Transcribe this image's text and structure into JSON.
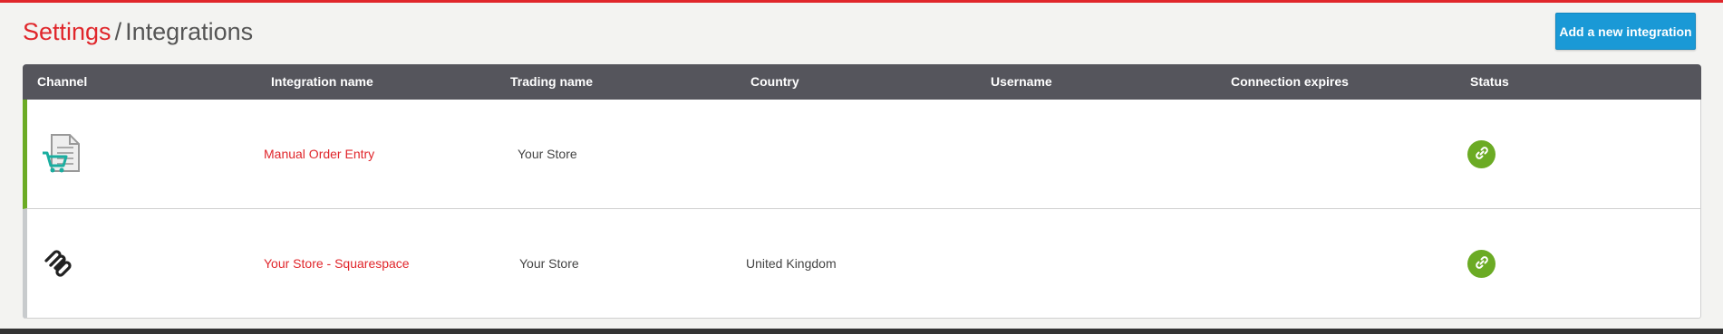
{
  "breadcrumb": {
    "parent": "Settings",
    "separator": "/",
    "current": "Integrations"
  },
  "actions": {
    "add_integration_label": "Add a new integration"
  },
  "table": {
    "columns": [
      "Channel",
      "Integration name",
      "Trading name",
      "Country",
      "Username",
      "Connection expires",
      "Status"
    ],
    "rows": [
      {
        "channel_icon": "manual-order-entry-icon",
        "integration_name": "Manual Order Entry",
        "trading_name": "Your Store",
        "country": "",
        "username": "",
        "connection_expires": "",
        "status_icon": "link-icon",
        "state": "active"
      },
      {
        "channel_icon": "squarespace-logo-icon",
        "integration_name": "Your Store - Squarespace",
        "trading_name": "Your Store",
        "country": "United Kingdom",
        "username": "",
        "connection_expires": "",
        "status_icon": "link-icon",
        "state": "inactive"
      }
    ]
  },
  "colors": {
    "brand_red": "#e0262b",
    "header_bg": "#55555c",
    "button_blue": "#1a99d6",
    "status_green": "#6bab24",
    "inactive_grey": "#c8cbcd"
  }
}
